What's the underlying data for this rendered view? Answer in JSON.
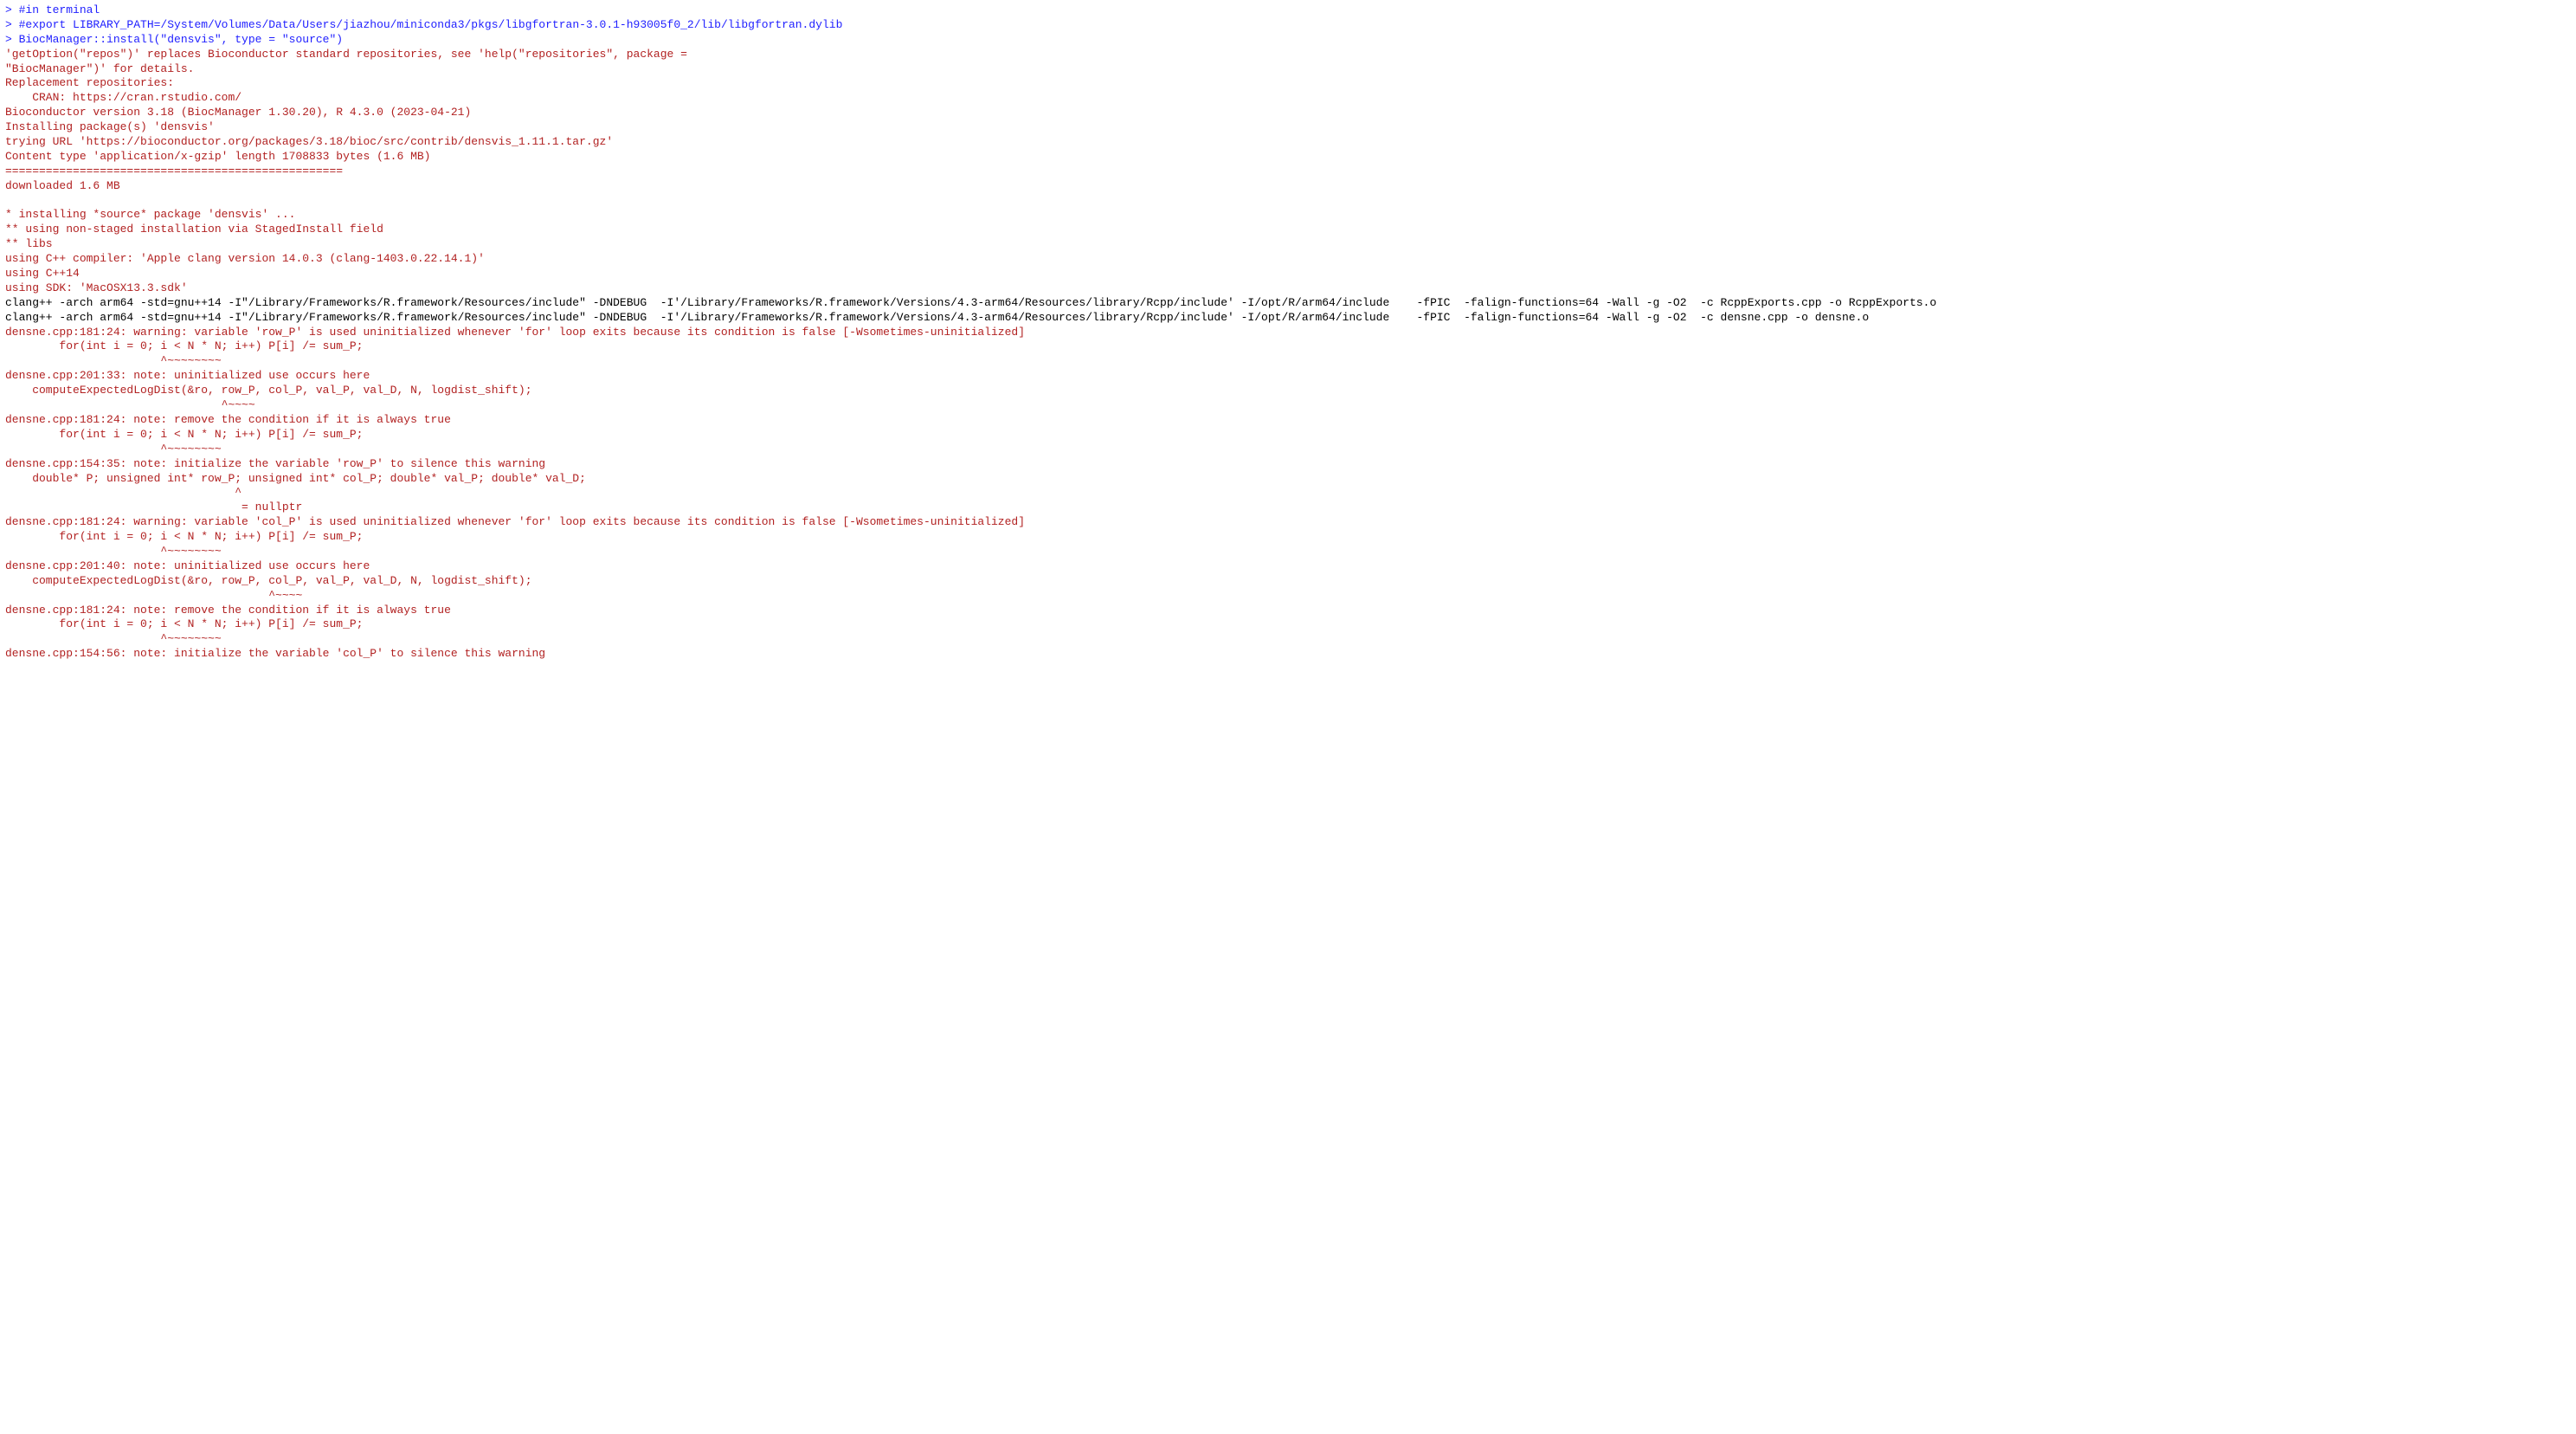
{
  "colors": {
    "prompt": "#1f1fff",
    "message": "#b22222",
    "plain": "#000000",
    "background": "#ffffff"
  },
  "console": {
    "lines": [
      {
        "kind": "input",
        "prompt": "> ",
        "text": "#in terminal"
      },
      {
        "kind": "input",
        "prompt": "> ",
        "text": "#export LIBRARY_PATH=/System/Volumes/Data/Users/jiazhou/miniconda3/pkgs/libgfortran-3.0.1-h93005f0_2/lib/libgfortran.dylib"
      },
      {
        "kind": "input",
        "prompt": "> ",
        "text": "BiocManager::install(\"densvis\", type = \"source\")"
      },
      {
        "kind": "msg",
        "text": "'getOption(\"repos\")' replaces Bioconductor standard repositories, see 'help(\"repositories\", package ="
      },
      {
        "kind": "msg",
        "text": "\"BiocManager\")' for details."
      },
      {
        "kind": "msg",
        "text": "Replacement repositories:"
      },
      {
        "kind": "msg",
        "text": "    CRAN: https://cran.rstudio.com/"
      },
      {
        "kind": "msg",
        "text": "Bioconductor version 3.18 (BiocManager 1.30.20), R 4.3.0 (2023-04-21)"
      },
      {
        "kind": "msg",
        "text": "Installing package(s) 'densvis'"
      },
      {
        "kind": "msg",
        "text": "trying URL 'https://bioconductor.org/packages/3.18/bioc/src/contrib/densvis_1.11.1.tar.gz'"
      },
      {
        "kind": "msg",
        "text": "Content type 'application/x-gzip' length 1708833 bytes (1.6 MB)"
      },
      {
        "kind": "msg",
        "text": "=================================================="
      },
      {
        "kind": "msg",
        "text": "downloaded 1.6 MB"
      },
      {
        "kind": "msg",
        "text": ""
      },
      {
        "kind": "msg",
        "text": "* installing *source* package 'densvis' ..."
      },
      {
        "kind": "msg",
        "text": "** using non-staged installation via StagedInstall field"
      },
      {
        "kind": "msg",
        "text": "** libs"
      },
      {
        "kind": "msg",
        "text": "using C++ compiler: 'Apple clang version 14.0.3 (clang-1403.0.22.14.1)'"
      },
      {
        "kind": "msg",
        "text": "using C++14"
      },
      {
        "kind": "msg",
        "text": "using SDK: 'MacOSX13.3.sdk'"
      },
      {
        "kind": "plain",
        "text": "clang++ -arch arm64 -std=gnu++14 -I\"/Library/Frameworks/R.framework/Resources/include\" -DNDEBUG  -I'/Library/Frameworks/R.framework/Versions/4.3-arm64/Resources/library/Rcpp/include' -I/opt/R/arm64/include    -fPIC  -falign-functions=64 -Wall -g -O2  -c RcppExports.cpp -o RcppExports.o"
      },
      {
        "kind": "plain",
        "text": "clang++ -arch arm64 -std=gnu++14 -I\"/Library/Frameworks/R.framework/Resources/include\" -DNDEBUG  -I'/Library/Frameworks/R.framework/Versions/4.3-arm64/Resources/library/Rcpp/include' -I/opt/R/arm64/include    -fPIC  -falign-functions=64 -Wall -g -O2  -c densne.cpp -o densne.o"
      },
      {
        "kind": "msg",
        "text": "densne.cpp:181:24: warning: variable 'row_P' is used uninitialized whenever 'for' loop exits because its condition is false [-Wsometimes-uninitialized]"
      },
      {
        "kind": "msg",
        "text": "        for(int i = 0; i < N * N; i++) P[i] /= sum_P;"
      },
      {
        "kind": "msg",
        "text": "                       ^~~~~~~~~"
      },
      {
        "kind": "msg",
        "text": "densne.cpp:201:33: note: uninitialized use occurs here"
      },
      {
        "kind": "msg",
        "text": "    computeExpectedLogDist(&ro, row_P, col_P, val_P, val_D, N, logdist_shift);"
      },
      {
        "kind": "msg",
        "text": "                                ^~~~~"
      },
      {
        "kind": "msg",
        "text": "densne.cpp:181:24: note: remove the condition if it is always true"
      },
      {
        "kind": "msg",
        "text": "        for(int i = 0; i < N * N; i++) P[i] /= sum_P;"
      },
      {
        "kind": "msg",
        "text": "                       ^~~~~~~~~"
      },
      {
        "kind": "msg",
        "text": "densne.cpp:154:35: note: initialize the variable 'row_P' to silence this warning"
      },
      {
        "kind": "msg",
        "text": "    double* P; unsigned int* row_P; unsigned int* col_P; double* val_P; double* val_D;"
      },
      {
        "kind": "msg",
        "text": "                                  ^"
      },
      {
        "kind": "msg",
        "text": "                                   = nullptr"
      },
      {
        "kind": "msg",
        "text": "densne.cpp:181:24: warning: variable 'col_P' is used uninitialized whenever 'for' loop exits because its condition is false [-Wsometimes-uninitialized]"
      },
      {
        "kind": "msg",
        "text": "        for(int i = 0; i < N * N; i++) P[i] /= sum_P;"
      },
      {
        "kind": "msg",
        "text": "                       ^~~~~~~~~"
      },
      {
        "kind": "msg",
        "text": "densne.cpp:201:40: note: uninitialized use occurs here"
      },
      {
        "kind": "msg",
        "text": "    computeExpectedLogDist(&ro, row_P, col_P, val_P, val_D, N, logdist_shift);"
      },
      {
        "kind": "msg",
        "text": "                                       ^~~~~"
      },
      {
        "kind": "msg",
        "text": "densne.cpp:181:24: note: remove the condition if it is always true"
      },
      {
        "kind": "msg",
        "text": "        for(int i = 0; i < N * N; i++) P[i] /= sum_P;"
      },
      {
        "kind": "msg",
        "text": "                       ^~~~~~~~~"
      },
      {
        "kind": "msg",
        "text": "densne.cpp:154:56: note: initialize the variable 'col_P' to silence this warning"
      }
    ]
  }
}
